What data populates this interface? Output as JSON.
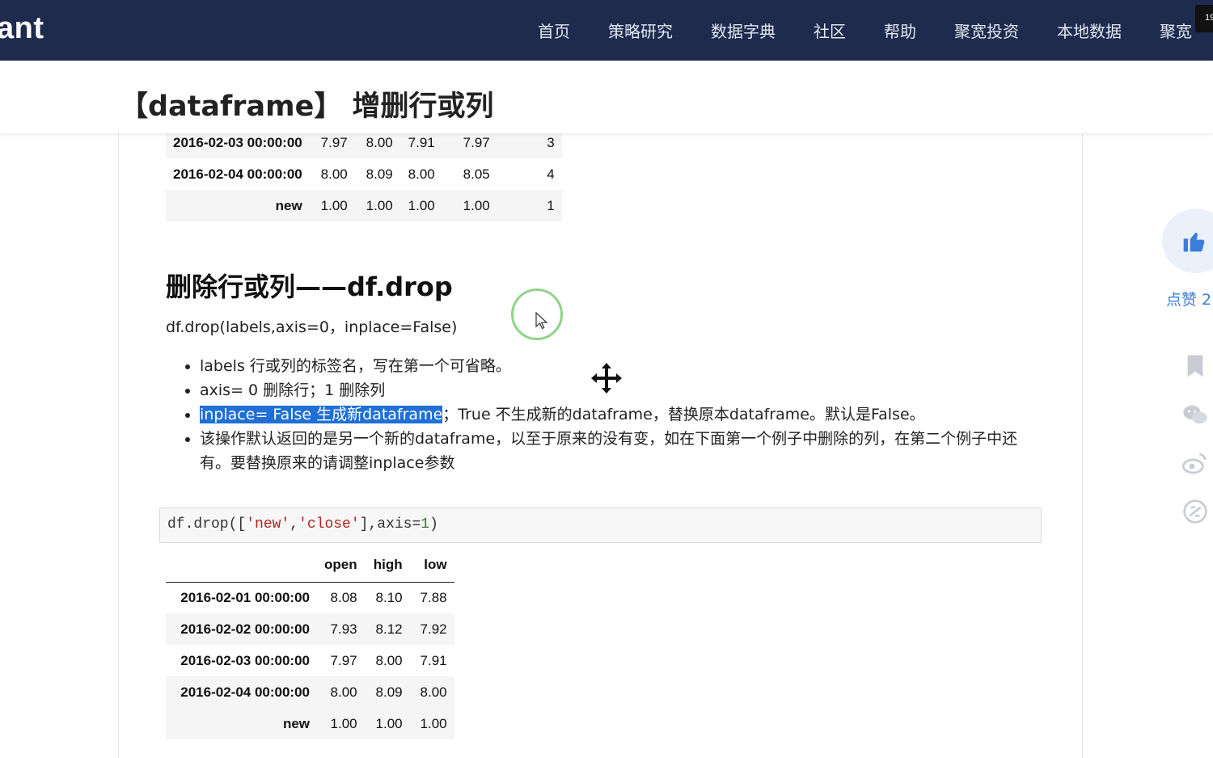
{
  "nav": {
    "brand": "ant",
    "items": [
      "首页",
      "策略研究",
      "数据字典",
      "社区",
      "帮助",
      "聚宽投资",
      "本地数据",
      "聚宽"
    ],
    "corner_badge": "19"
  },
  "page": {
    "title": "【dataframe】 增删行或列"
  },
  "table_top": {
    "rows": [
      {
        "index": "2016-02-03 00:00:00",
        "cells": [
          "7.97",
          "8.00",
          "7.91",
          "7.97",
          "3"
        ]
      },
      {
        "index": "2016-02-04 00:00:00",
        "cells": [
          "8.00",
          "8.09",
          "8.00",
          "8.05",
          "4"
        ]
      },
      {
        "index": "new",
        "cells": [
          "1.00",
          "1.00",
          "1.00",
          "1.00",
          "1"
        ]
      }
    ]
  },
  "section": {
    "heading": "删除行或列——df.drop",
    "signature": "df.drop(labels,axis=0，inplace=False)",
    "bullets": [
      "labels 行或列的标签名，写在第一个可省略。",
      "axis= 0 删除行；1 删除列",
      "该操作默认返回的是另一个新的dataframe，以至于原来的没有变，如在下面第一个例子中删除的列，在第二个例子中还有。要替换原来的请调整inplace参数"
    ],
    "inplace_highlight": "inplace= False 生成新dataframe",
    "inplace_rest": "；True 不生成新的dataframe，替换原本dataframe。默认是False。"
  },
  "code": {
    "prefix": "df.drop([",
    "str1": "'new'",
    "comma": ",",
    "str2": "'close'",
    "mid": "],axis=",
    "num": "1",
    "suffix": ")"
  },
  "table_bottom": {
    "columns": [
      "open",
      "high",
      "low"
    ],
    "rows": [
      {
        "index": "2016-02-01 00:00:00",
        "cells": [
          "8.08",
          "8.10",
          "7.88"
        ]
      },
      {
        "index": "2016-02-02 00:00:00",
        "cells": [
          "7.93",
          "8.12",
          "7.92"
        ]
      },
      {
        "index": "2016-02-03 00:00:00",
        "cells": [
          "7.97",
          "8.00",
          "7.91"
        ]
      },
      {
        "index": "2016-02-04 00:00:00",
        "cells": [
          "8.00",
          "8.09",
          "8.00"
        ]
      },
      {
        "index": "new",
        "cells": [
          "1.00",
          "1.00",
          "1.00"
        ]
      }
    ]
  },
  "sidebar": {
    "like_label": "点赞 2",
    "icons": [
      "thumbs-up-icon",
      "bookmark-icon",
      "wechat-icon",
      "weibo-icon",
      "share-icon"
    ],
    "accent_color": "#3b7dd8"
  },
  "colors": {
    "nav_bg": "#1e2b4f",
    "selection": "#1f6fd6"
  }
}
